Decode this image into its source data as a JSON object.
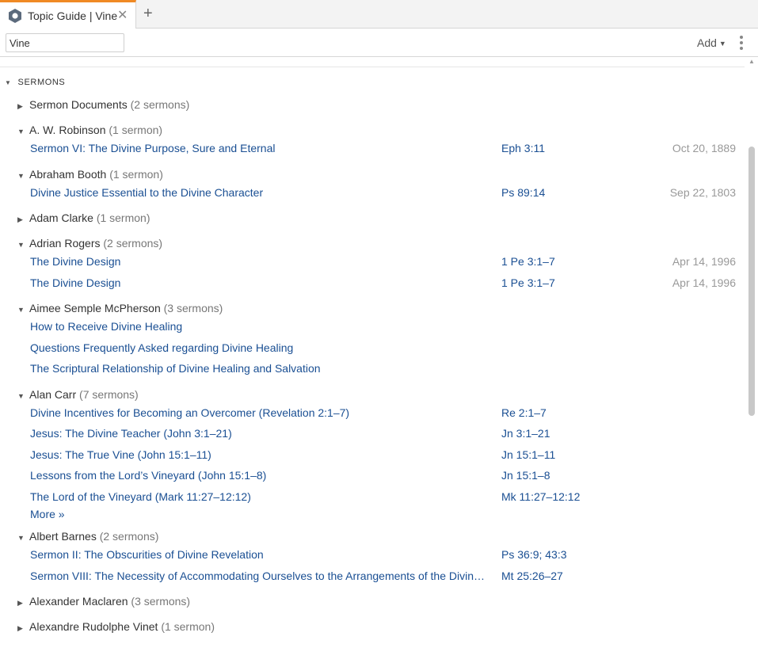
{
  "tab": {
    "title": "Topic Guide | Vine",
    "close": "✕",
    "add": "+"
  },
  "toolbar": {
    "search_value": "Vine",
    "add_label": "Add"
  },
  "section": {
    "title": "SERMONS"
  },
  "groups": [
    {
      "author": "Sermon Documents",
      "count": "(2 sermons)",
      "expanded": false,
      "items": []
    },
    {
      "author": "A. W. Robinson",
      "count": "(1 sermon)",
      "expanded": true,
      "items": [
        {
          "title": "Sermon VI: The Divine Purpose, Sure and Eternal",
          "ref": "Eph 3:11",
          "date": "Oct 20, 1889"
        }
      ]
    },
    {
      "author": "Abraham Booth",
      "count": "(1 sermon)",
      "expanded": true,
      "items": [
        {
          "title": "Divine Justice Essential to the Divine Character",
          "ref": "Ps 89:14",
          "date": "Sep 22, 1803"
        }
      ]
    },
    {
      "author": "Adam Clarke",
      "count": "(1 sermon)",
      "expanded": false,
      "items": []
    },
    {
      "author": "Adrian Rogers",
      "count": "(2 sermons)",
      "expanded": true,
      "items": [
        {
          "title": "The Divine Design",
          "ref": "1 Pe 3:1–7",
          "date": "Apr 14, 1996"
        },
        {
          "title": "The Divine Design",
          "ref": "1 Pe 3:1–7",
          "date": "Apr 14, 1996"
        }
      ]
    },
    {
      "author": "Aimee Semple McPherson",
      "count": "(3 sermons)",
      "expanded": true,
      "items": [
        {
          "title": "How to Receive Divine Healing",
          "ref": "",
          "date": ""
        },
        {
          "title": "Questions Frequently Asked regarding Divine Healing",
          "ref": "",
          "date": ""
        },
        {
          "title": "The Scriptural Relationship of Divine Healing and Salvation",
          "ref": "",
          "date": ""
        }
      ]
    },
    {
      "author": "Alan Carr",
      "count": "(7 sermons)",
      "expanded": true,
      "items": [
        {
          "title": "Divine Incentives for Becoming an Overcomer (Revelation 2:1–7)",
          "ref": "Re 2:1–7",
          "date": ""
        },
        {
          "title": "Jesus: The Divine Teacher (John 3:1–21)",
          "ref": "Jn 3:1–21",
          "date": ""
        },
        {
          "title": "Jesus: The True Vine (John 15:1–11)",
          "ref": "Jn 15:1–11",
          "date": ""
        },
        {
          "title": "Lessons from the Lord’s Vineyard (John 15:1–8)",
          "ref": "Jn 15:1–8",
          "date": ""
        },
        {
          "title": "The Lord of the Vineyard (Mark 11:27–12:12)",
          "ref": "Mk 11:27–12:12",
          "date": ""
        }
      ],
      "more": "More »"
    },
    {
      "author": "Albert Barnes",
      "count": "(2 sermons)",
      "expanded": true,
      "items": [
        {
          "title": "Sermon II: The Obscurities of Divine Revelation",
          "ref": "Ps 36:9; 43:3",
          "date": ""
        },
        {
          "title": "Sermon VIII: The Necessity of Accommodating Ourselves to the Arrangements of the Divine Providence",
          "ref": "Mt 25:26–27",
          "date": ""
        }
      ]
    },
    {
      "author": "Alexander Maclaren",
      "count": "(3 sermons)",
      "expanded": false,
      "items": []
    },
    {
      "author": "Alexandre Rudolphe Vinet",
      "count": "(1 sermon)",
      "expanded": false,
      "items": []
    }
  ]
}
